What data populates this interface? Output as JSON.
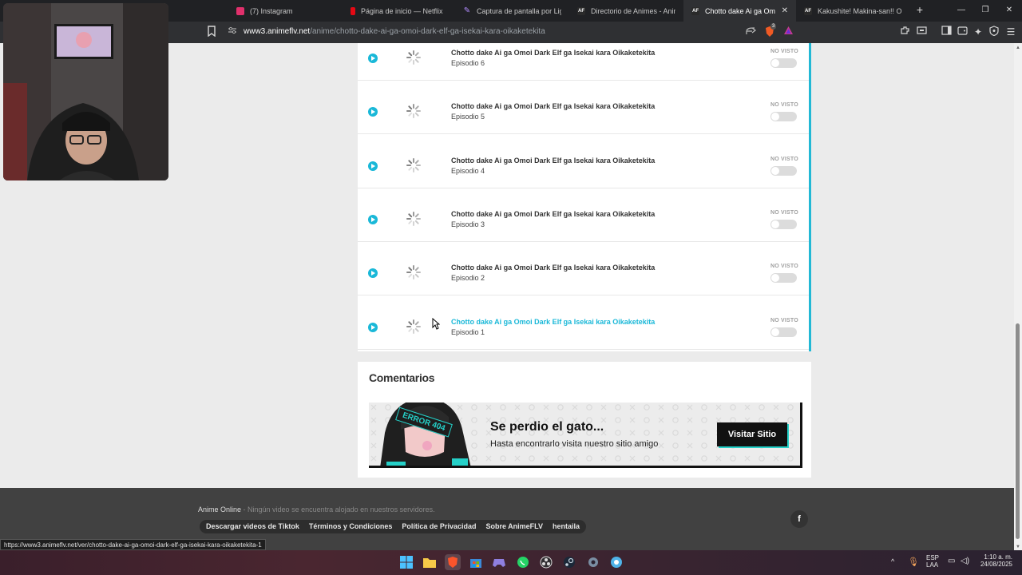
{
  "browser": {
    "tabs": [
      {
        "title": "(7) Instagram",
        "icon": "instagram-icon",
        "color": "#e1306c",
        "active": false
      },
      {
        "title": "Página de inicio — Netflix",
        "icon": "netflix-icon",
        "color": "#e50914",
        "active": false
      },
      {
        "title": "Captura de pantalla por Lightshot",
        "icon": "feather-icon",
        "color": "#9b59ff",
        "active": false
      },
      {
        "title": "Directorio de Animes - AnimeFLV",
        "icon": "animeflv-icon",
        "color": "#2a2a2a",
        "active": false
      },
      {
        "title": "Chotto dake Ai ga Omoi Dark Elf",
        "icon": "animeflv-icon",
        "color": "#2a2a2a",
        "active": true
      },
      {
        "title": "Kakushite! Makina-san!! Online",
        "icon": "animeflv-icon",
        "color": "#2a2a2a",
        "active": false
      }
    ],
    "close_tab": "✕",
    "new_tab": "+",
    "url_domain": "www3.animeflv.net",
    "url_path": "/anime/chotto-dake-ai-ga-omoi-dark-elf-ga-isekai-kara-oikaketekita",
    "brave_badge": "3"
  },
  "episodes": [
    {
      "title": "Chotto dake Ai ga Omoi Dark Elf ga Isekai kara Oikaketekita",
      "episode": "Episodio 6",
      "status": "NO VISTO",
      "watched": false,
      "hover": false
    },
    {
      "title": "Chotto dake Ai ga Omoi Dark Elf ga Isekai kara Oikaketekita",
      "episode": "Episodio 5",
      "status": "NO VISTO",
      "watched": false,
      "hover": false
    },
    {
      "title": "Chotto dake Ai ga Omoi Dark Elf ga Isekai kara Oikaketekita",
      "episode": "Episodio 4",
      "status": "NO VISTO",
      "watched": false,
      "hover": false
    },
    {
      "title": "Chotto dake Ai ga Omoi Dark Elf ga Isekai kara Oikaketekita",
      "episode": "Episodio 3",
      "status": "NO VISTO",
      "watched": false,
      "hover": false
    },
    {
      "title": "Chotto dake Ai ga Omoi Dark Elf ga Isekai kara Oikaketekita",
      "episode": "Episodio 2",
      "status": "NO VISTO",
      "watched": false,
      "hover": false
    },
    {
      "title": "Chotto dake Ai ga Omoi Dark Elf ga Isekai kara Oikaketekita",
      "episode": "Episodio 1",
      "status": "NO VISTO",
      "watched": false,
      "hover": true
    }
  ],
  "comments": {
    "title": "Comentarios",
    "banner": {
      "badge": "ERROR 404",
      "title": "Se perdio el gato...",
      "subtitle": "Hasta encontrarlo visita nuestro sitio amigo",
      "button": "Visitar Sitio"
    }
  },
  "footer": {
    "brand": "Anime Online",
    "disclaimer": " - Ningún video se encuentra alojado en nuestros servidores.",
    "links": [
      "Descargar videos de Tiktok",
      "Términos y Condiciones",
      "Política de Privacidad",
      "Sobre AnimeFLV",
      "hentaila"
    ],
    "social_icon": "facebook-icon",
    "social_glyph": "f"
  },
  "status_bar_url": "https://www3.animeflv.net/ver/chotto-dake-ai-ga-omoi-dark-elf-ga-isekai-kara-oikaketekita-1",
  "taskbar": {
    "apps": [
      "windows-start-icon",
      "file-explorer-icon",
      "brave-browser-icon",
      "microsoft-store-icon",
      "game-launcher-icon",
      "whatsapp-icon",
      "obs-icon",
      "steam-icon",
      "settings-icon",
      "app-icon"
    ],
    "lang": "ESP",
    "layout": "LAA",
    "time": "1:10 a. m.",
    "date": "24/08/2025"
  },
  "colors": {
    "accent": "#1ab8d8",
    "page_bg": "#ebebeb",
    "footer_bg": "#414141"
  }
}
